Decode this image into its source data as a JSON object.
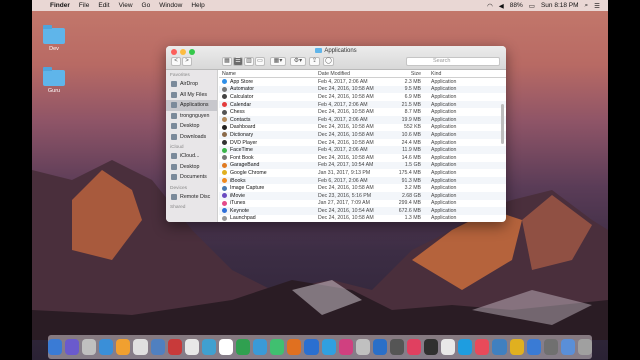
{
  "menubar": {
    "app": "Finder",
    "items": [
      "File",
      "Edit",
      "View",
      "Go",
      "Window",
      "Help"
    ],
    "battery": "88%",
    "clock": "Sun 8:18 PM"
  },
  "desktop": {
    "icons": [
      {
        "label": "Dev"
      },
      {
        "label": "Guru"
      }
    ]
  },
  "window": {
    "title": "Applications",
    "search_placeholder": "Search",
    "back": "<",
    "forward": ">",
    "sidebar": {
      "favorites_header": "Favorites",
      "favorites": [
        "AirDrop",
        "All My Files",
        "Applications",
        "trongnguyen",
        "Desktop",
        "Downloads"
      ],
      "icloud_header": "iCloud",
      "icloud": [
        "iCloud...",
        "Desktop",
        "Documents"
      ],
      "devices_header": "Devices",
      "devices": [
        "Remote Disc"
      ],
      "shared_header": "Shared"
    },
    "columns": {
      "name": "Name",
      "date": "Date Modified",
      "size": "Size",
      "kind": "Kind"
    },
    "rows": [
      {
        "name": "App Store",
        "date": "Feb 4, 2017, 2:06 AM",
        "size": "2.3 MB",
        "kind": "Application",
        "color": "#2f8fe8"
      },
      {
        "name": "Automator",
        "date": "Dec 24, 2016, 10:58 AM",
        "size": "9.5 MB",
        "kind": "Application",
        "color": "#777777"
      },
      {
        "name": "Calculator",
        "date": "Dec 24, 2016, 10:58 AM",
        "size": "6.9 MB",
        "kind": "Application",
        "color": "#444444"
      },
      {
        "name": "Calendar",
        "date": "Feb 4, 2017, 2:06 AM",
        "size": "21.5 MB",
        "kind": "Application",
        "color": "#e33d3d"
      },
      {
        "name": "Chess",
        "date": "Dec 24, 2016, 10:58 AM",
        "size": "8.7 MB",
        "kind": "Application",
        "color": "#555555"
      },
      {
        "name": "Contacts",
        "date": "Feb 4, 2017, 2:06 AM",
        "size": "19.9 MB",
        "kind": "Application",
        "color": "#b48a5a"
      },
      {
        "name": "Dashboard",
        "date": "Dec 24, 2016, 10:58 AM",
        "size": "552 KB",
        "kind": "Application",
        "color": "#222222"
      },
      {
        "name": "Dictionary",
        "date": "Dec 24, 2016, 10:58 AM",
        "size": "10.6 MB",
        "kind": "Application",
        "color": "#8a6a4a"
      },
      {
        "name": "DVD Player",
        "date": "Dec 24, 2016, 10:58 AM",
        "size": "24.4 MB",
        "kind": "Application",
        "color": "#333333"
      },
      {
        "name": "FaceTime",
        "date": "Feb 4, 2017, 2:06 AM",
        "size": "11.9 MB",
        "kind": "Application",
        "color": "#3bb54a"
      },
      {
        "name": "Font Book",
        "date": "Dec 24, 2016, 10:58 AM",
        "size": "14.6 MB",
        "kind": "Application",
        "color": "#777777"
      },
      {
        "name": "GarageBand",
        "date": "Feb 24, 2017, 10:54 AM",
        "size": "1.5 GB",
        "kind": "Application",
        "color": "#e07a22"
      },
      {
        "name": "Google Chrome",
        "date": "Jan 31, 2017, 9:13 PM",
        "size": "175.4 MB",
        "kind": "Application",
        "color": "#e0b020"
      },
      {
        "name": "iBooks",
        "date": "Feb 6, 2017, 2:06 AM",
        "size": "91.3 MB",
        "kind": "Application",
        "color": "#f08a1e"
      },
      {
        "name": "Image Capture",
        "date": "Dec 24, 2016, 10:58 AM",
        "size": "3.2 MB",
        "kind": "Application",
        "color": "#4a7ab0"
      },
      {
        "name": "iMovie",
        "date": "Dec 23, 2016, 5:16 PM",
        "size": "2.68 GB",
        "kind": "Application",
        "color": "#6a4ac0"
      },
      {
        "name": "iTunes",
        "date": "Jan 27, 2017, 7:09 AM",
        "size": "299.4 MB",
        "kind": "Application",
        "color": "#e44a8a"
      },
      {
        "name": "Keynote",
        "date": "Dec 24, 2016, 10:54 AM",
        "size": "672.6 MB",
        "kind": "Application",
        "color": "#2f6fd8"
      },
      {
        "name": "Launchpad",
        "date": "Dec 24, 2016, 10:58 AM",
        "size": "1.3 MB",
        "kind": "Application",
        "color": "#999999"
      }
    ]
  },
  "dock": {
    "colors": [
      "#3a7bd5",
      "#6a5acd",
      "#c0c0c0",
      "#3a8fd8",
      "#f0a030",
      "#e0e0e0",
      "#5080c0",
      "#c83a3a",
      "#e8e8e8",
      "#40a0d0",
      "#ffffff",
      "#30a050",
      "#3a9ad8",
      "#40c070",
      "#e07020",
      "#2a6fd0",
      "#30a0e0",
      "#d04080",
      "#c0c0c0",
      "#2a6fc8",
      "#555555",
      "#e04060",
      "#303030",
      "#e8e8e8",
      "#1e9de0",
      "#e84a5a",
      "#4080c0",
      "#e0b020",
      "#3a7bd5",
      "#707070",
      "#5a8fd8",
      "#a0a0a0"
    ]
  }
}
